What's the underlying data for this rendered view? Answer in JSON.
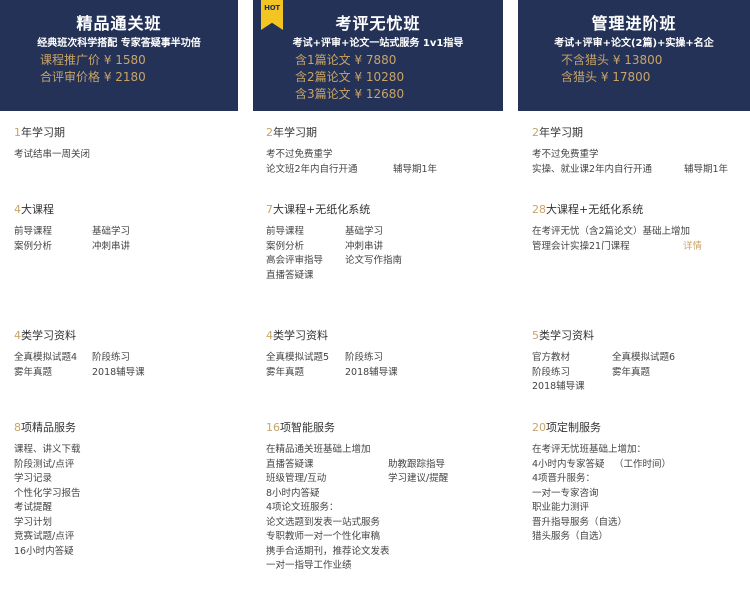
{
  "columns": [
    {
      "name": "精品通关班",
      "subtitle": "经典班次科学搭配 专家答疑事半功倍",
      "prices": [
        "课程推广价 ¥ 1580",
        "合评审价格 ¥ 2180"
      ],
      "sections": [
        {
          "num": "1",
          "title": "年学习期",
          "rows": [
            [
              "考试结串一周关闭"
            ]
          ]
        },
        {
          "num": "4",
          "title": "大课程",
          "rows": [
            [
              "前导课程",
              "基础学习"
            ],
            [
              "案例分析",
              "冲刺串讲"
            ]
          ]
        },
        {
          "num": "4",
          "title": "类学习资料",
          "rows": [
            [
              "全真模拟试题4",
              "阶段练习"
            ],
            [
              "雾年真题",
              "2018辅导课"
            ]
          ]
        },
        {
          "num": "8",
          "title": "项精品服务",
          "rows": [
            [
              "课程、讲义下载"
            ],
            [
              "阶段测试/点评"
            ],
            [
              "学习记录"
            ],
            [
              "个性化学习报告"
            ],
            [
              "考试提醒"
            ],
            [
              "学习计划"
            ],
            [
              "竞赛试题/点评"
            ],
            [
              "16小时内答疑"
            ]
          ]
        }
      ]
    },
    {
      "name": "考评无忧班",
      "badge": "HOT",
      "subtitle": "考试+评审+论文一站式服务 1v1指导",
      "prices": [
        "含1篇论文 ¥ 7880",
        "含2篇论文 ¥ 10280",
        "含3篇论文 ¥ 12680"
      ],
      "sections": [
        {
          "num": "2",
          "title": "年学习期",
          "rows": [
            [
              "考不过免费重学"
            ],
            [
              "论文班2年内自行开通",
              "辅导期1年"
            ]
          ]
        },
        {
          "num": "7",
          "title": "大课程+无纸化系统",
          "rows": [
            [
              "前导课程",
              "基础学习"
            ],
            [
              "案例分析",
              "冲刺串讲"
            ],
            [
              "高会评审指导",
              "论文写作指南"
            ],
            [
              "直播答疑课"
            ]
          ]
        },
        {
          "num": "4",
          "title": "类学习资料",
          "rows": [
            [
              "全真模拟试题5",
              "阶段练习"
            ],
            [
              "雾年真题",
              "2018辅导课"
            ]
          ]
        },
        {
          "num": "16",
          "title": "项智能服务",
          "rows": [
            [
              "在精品通关班基础上增加"
            ],
            [
              "直播答疑课",
              "助教跟踪指导"
            ],
            [
              "班级管理/互动",
              "学习建议/提醒"
            ],
            [
              "8小时内答疑"
            ],
            [
              "4项论文班服务："
            ],
            [
              "论文选题到发表一站式服务"
            ],
            [
              "专职教师一对一个性化审稿"
            ],
            [
              "携手合适期刊，推荐论文发表"
            ],
            [
              "一对一指导工作业绩"
            ]
          ]
        }
      ]
    },
    {
      "name": "管理进阶班",
      "subtitle": "考试+评审+论文(2篇)+实操+名企",
      "prices": [
        "不含猎头 ¥ 13800",
        "含猎头 ¥ 17800"
      ],
      "sections": [
        {
          "num": "2",
          "title": "年学习期",
          "rows": [
            [
              "考不过免费重学"
            ],
            [
              "实操、就业课2年内自行开通",
              "辅导期1年"
            ]
          ]
        },
        {
          "num": "28",
          "title": "大课程+无纸化系统",
          "rows": [
            [
              "在考评无忧（含2篇论文）基础上增加"
            ],
            [
              "管理会计实操21门课程",
              "详情"
            ]
          ]
        },
        {
          "num": "5",
          "title": "类学习资料",
          "rows": [
            [
              "官方教材",
              "全真模拟试题6"
            ],
            [
              "阶段练习",
              "雾年真题"
            ],
            [
              "2018辅导课"
            ]
          ]
        },
        {
          "num": "20",
          "title": "项定制服务",
          "rows": [
            [
              "在考评无忧班基础上增加："
            ],
            [
              "4小时内专家答疑",
              "（工作时间）"
            ],
            [
              "4项晋升服务："
            ],
            [
              "一对一专家咨询"
            ],
            [
              "职业能力测评"
            ],
            [
              "晋升指导服务（自选）"
            ],
            [
              "猎头服务（自选）"
            ]
          ]
        }
      ]
    }
  ]
}
